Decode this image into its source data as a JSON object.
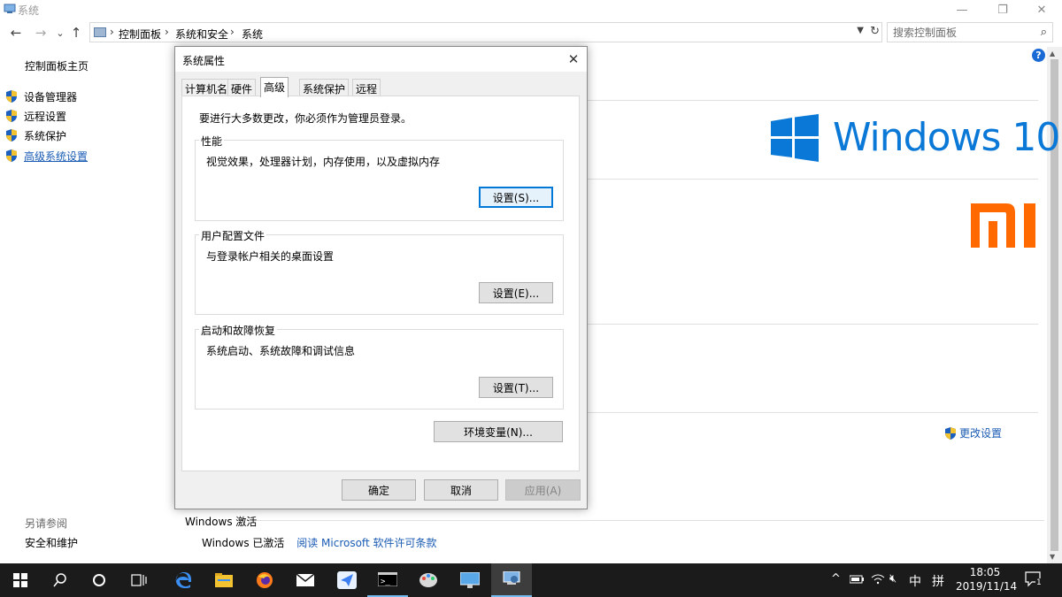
{
  "window": {
    "title": "系统",
    "controls": {
      "minimize": "—",
      "maximize": "❐",
      "close": "✕"
    }
  },
  "nav": {
    "back": "←",
    "forward": "→",
    "recent": "⌄",
    "up": "↑",
    "breadcrumbs": [
      "控制面板",
      "系统和安全",
      "系统"
    ],
    "separator": "›",
    "refresh": "↻",
    "search_placeholder": "搜索控制面板"
  },
  "left_pane": {
    "home": "控制面板主页",
    "tasks": [
      "设备管理器",
      "远程设置",
      "系统保护",
      "高级系统设置"
    ],
    "see_also_label": "另请参阅",
    "see_also_items": [
      "安全和维护"
    ]
  },
  "main": {
    "brand": "Windows 10",
    "change_settings": "更改设置",
    "activation_heading": "Windows 激活",
    "activation_status": "Windows 已激活",
    "license_link": "阅读 Microsoft 软件许可条款",
    "help": "?"
  },
  "dialog": {
    "title": "系统属性",
    "close": "✕",
    "tabs": [
      "计算机名",
      "硬件",
      "高级",
      "系统保护",
      "远程"
    ],
    "active_tab": "高级",
    "admin_note": "要进行大多数更改，你必须作为管理员登录。",
    "performance": {
      "title": "性能",
      "desc": "视觉效果，处理器计划，内存使用，以及虚拟内存",
      "button": "设置(S)..."
    },
    "user_profiles": {
      "title": "用户配置文件",
      "desc": "与登录帐户相关的桌面设置",
      "button": "设置(E)..."
    },
    "startup_recovery": {
      "title": "启动和故障恢复",
      "desc": "系统启动、系统故障和调试信息",
      "button": "设置(T)..."
    },
    "env_button": "环境变量(N)...",
    "ok": "确定",
    "cancel": "取消",
    "apply": "应用(A)"
  },
  "taskbar": {
    "tray": {
      "chevron": "^",
      "input_mode": "中",
      "ime": "拼"
    },
    "time": "18:05",
    "date": "2019/11/14",
    "notification_count": "1"
  },
  "colors": {
    "windows_blue": "#0a78d7",
    "mi_orange": "#ff6900",
    "link": "#1a5bb4",
    "taskbar": "#1b1b1b"
  }
}
